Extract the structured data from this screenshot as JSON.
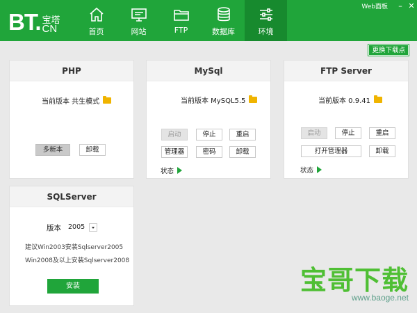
{
  "header": {
    "logo_bt": "BT.",
    "logo_cn_top": "宝塔",
    "logo_cn_bottom": "CN",
    "nav": [
      {
        "label": "首页",
        "icon": "home-icon"
      },
      {
        "label": "网站",
        "icon": "monitor-icon"
      },
      {
        "label": "FTP",
        "icon": "folder-icon"
      },
      {
        "label": "数据库",
        "icon": "database-icon"
      },
      {
        "label": "环境",
        "icon": "sliders-icon"
      }
    ],
    "active_nav": "环境",
    "web_panel": "Web面板",
    "minimize_glyph": "–",
    "close_glyph": "✕"
  },
  "switch_link": "更换下载点",
  "php": {
    "title": "PHP",
    "version_label": "当前版本 共生模式",
    "btn_multi": "多新本",
    "btn_uninstall": "卸载"
  },
  "mysql": {
    "title": "MySql",
    "version_label": "当前版本 MySQL5.5",
    "btn_start": "启动",
    "btn_stop": "停止",
    "btn_restart": "重启",
    "btn_manager": "管理器",
    "btn_password": "密码",
    "btn_uninstall": "卸载",
    "status": "状态"
  },
  "ftp": {
    "title": "FTP Server",
    "version_label": "当前版本 0.9.41",
    "btn_start": "启动",
    "btn_stop": "停止",
    "btn_restart": "重启",
    "btn_open_manager": "打开管理器",
    "btn_uninstall": "卸载",
    "status": "状态"
  },
  "sqlserver": {
    "title": "SQLServer",
    "version_label": "版本",
    "version_value": "2005",
    "tip1": "建议Win2003安装Sqlserver2005",
    "tip2": "Win2008及以上安装Sqlserver2008",
    "btn_install": "安装"
  },
  "watermark": {
    "text": "宝哥下载",
    "url": "www.baoge.net"
  },
  "colors": {
    "brand_green": "#20a53a",
    "active_nav": "#178a2e",
    "folder": "#f0b400"
  }
}
